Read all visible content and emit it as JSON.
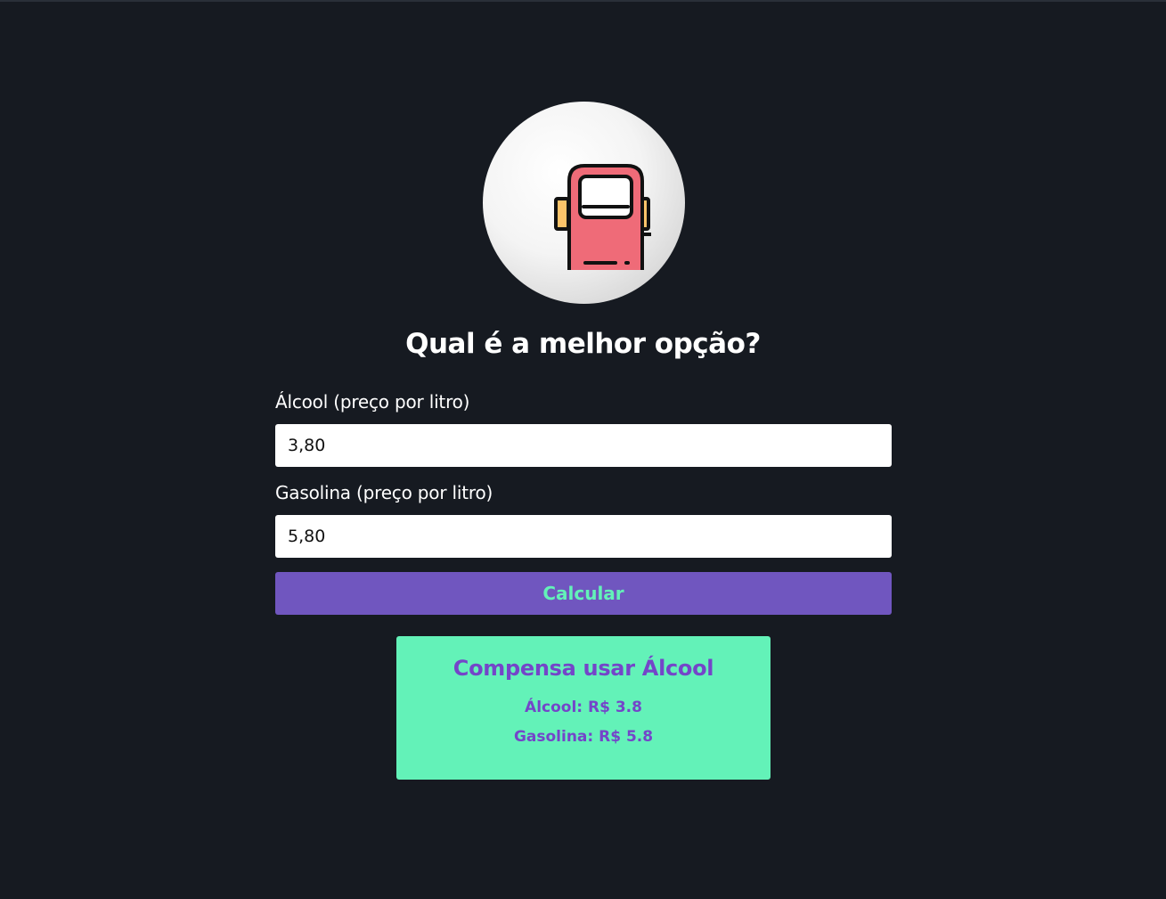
{
  "logo": {
    "icon": "fuel-pump-icon"
  },
  "title": "Qual é a melhor opção?",
  "form": {
    "alcohol_label": "Álcool (preço por litro)",
    "alcohol_value": "3,80",
    "gasoline_label": "Gasolina (preço por litro)",
    "gasoline_value": "5,80",
    "submit_label": "Calcular"
  },
  "result": {
    "title": "Compensa usar Álcool",
    "alcohol_line": "Álcool: R$ 3.8",
    "gasoline_line": "Gasolina: R$ 5.8"
  },
  "colors": {
    "background": "#161a21",
    "button": "#7056bf",
    "accent_green": "#63f2b8",
    "accent_purple": "#7445c9",
    "pump_red": "#ef6b78",
    "pump_yellow": "#fdc46a"
  }
}
